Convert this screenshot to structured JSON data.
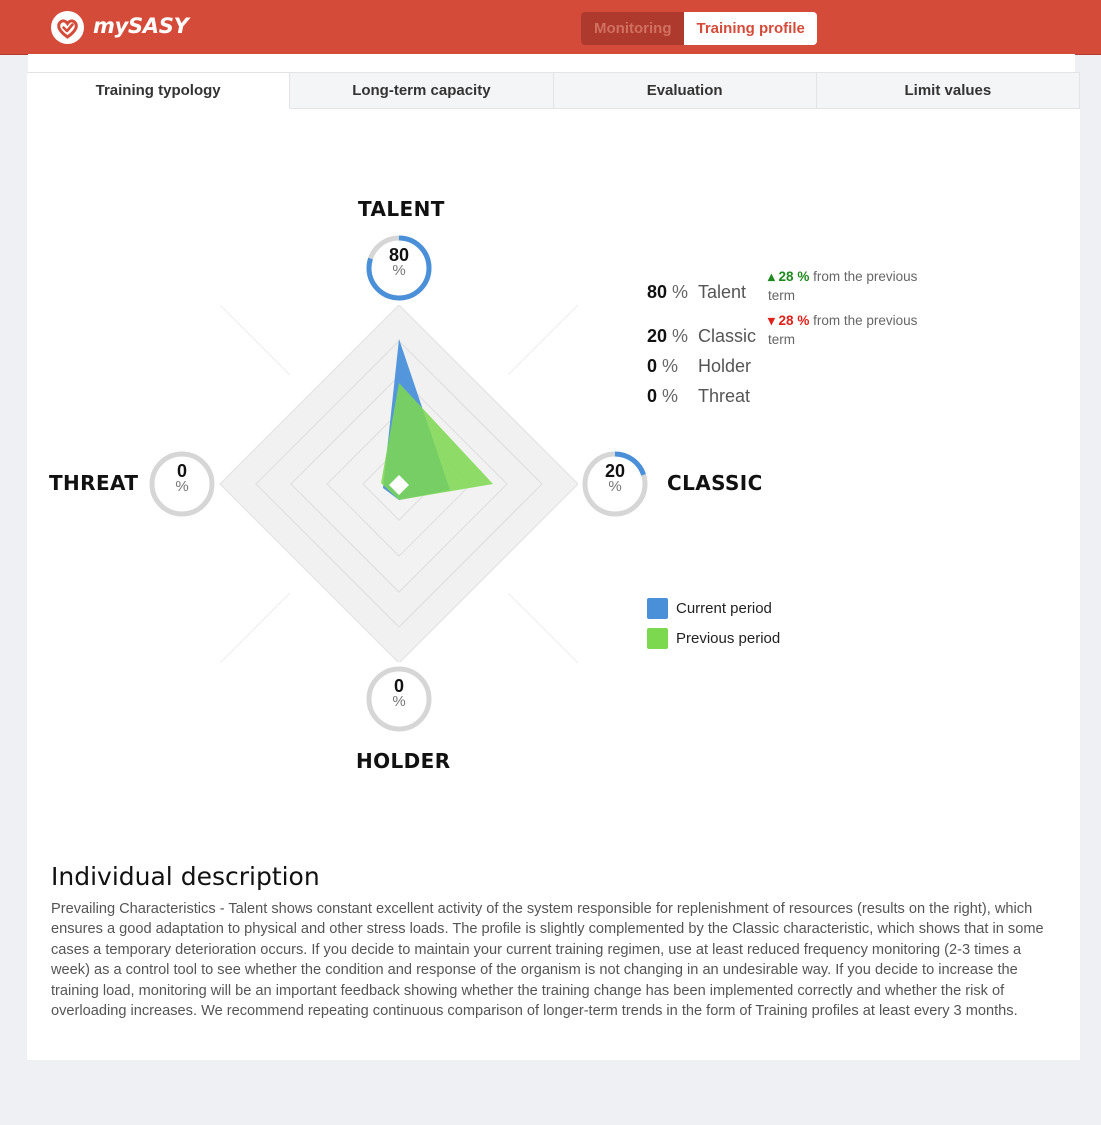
{
  "app": {
    "name": "mySASY",
    "nav": {
      "monitoring": "Monitoring",
      "training_profile": "Training profile"
    }
  },
  "tabs": [
    {
      "label": "Training typology",
      "active": true
    },
    {
      "label": "Long-term capacity",
      "active": false
    },
    {
      "label": "Evaluation",
      "active": false
    },
    {
      "label": "Limit values",
      "active": false
    }
  ],
  "radar": {
    "axes": {
      "talent": {
        "label": "TALENT",
        "value": "80",
        "percent": "%"
      },
      "classic": {
        "label": "CLASSIC",
        "value": "20",
        "percent": "%"
      },
      "holder": {
        "label": "HOLDER",
        "value": "0",
        "percent": "%"
      },
      "threat": {
        "label": "THREAT",
        "value": "0",
        "percent": "%"
      }
    },
    "colors": {
      "current": "#4a90d9",
      "previous": "#7cd84f",
      "grid": "#f1f1f1"
    }
  },
  "stats": [
    {
      "value": "80",
      "unit": "%",
      "name": "Talent",
      "delta_value": "28 %",
      "delta_dir": "up",
      "delta_text": "from the previous term"
    },
    {
      "value": "20",
      "unit": "%",
      "name": "Classic",
      "delta_value": "28 %",
      "delta_dir": "down",
      "delta_text": "from the previous term"
    },
    {
      "value": "0",
      "unit": "%",
      "name": "Holder"
    },
    {
      "value": "0",
      "unit": "%",
      "name": "Threat"
    }
  ],
  "legend": {
    "current": "Current period",
    "previous": "Previous period"
  },
  "description": {
    "title": "Individual description",
    "body": "Prevailing Characteristics - Talent shows constant excellent activity of the system responsible for replenishment of resources (results on the right), which ensures a good adaptation to physical and other stress loads. The profile is slightly complemented by the Classic characteristic, which shows that in some cases a temporary deterioration occurs. If you decide to maintain your current training regimen, use at least reduced frequency monitoring (2-3 times a week) as a control tool to see whether the condition and response of the organism is not changing in an undesirable way. If you decide to increase the training load, monitoring will be an important feedback showing whether the training change has been implemented correctly and whether the risk of overloading increases. We recommend repeating continuous comparison of longer-term trends in the form of Training profiles at least every 3 months."
  }
}
